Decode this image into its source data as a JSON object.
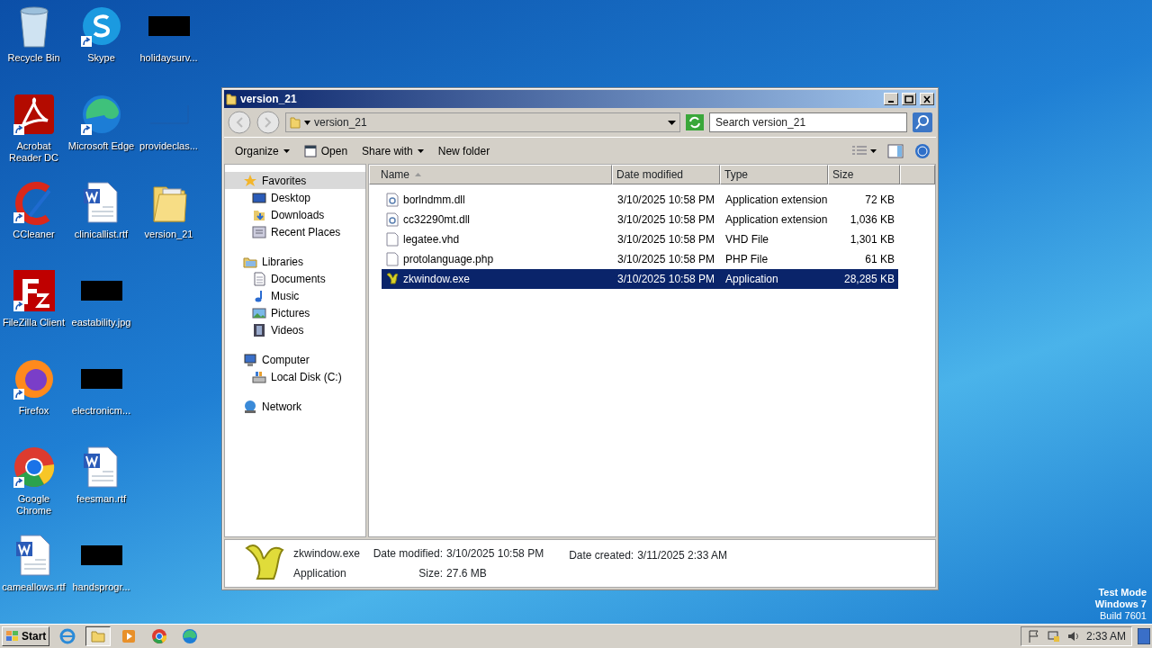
{
  "desktop_icons": [
    {
      "label": "Recycle Bin",
      "kind": "recycle-bin",
      "shortcut": false
    },
    {
      "label": "Acrobat Reader DC",
      "kind": "acrobat",
      "shortcut": true
    },
    {
      "label": "CCleaner",
      "kind": "ccleaner",
      "shortcut": true
    },
    {
      "label": "FileZilla Client",
      "kind": "filezilla",
      "shortcut": true
    },
    {
      "label": "Firefox",
      "kind": "firefox",
      "shortcut": true
    },
    {
      "label": "Google Chrome",
      "kind": "chrome",
      "shortcut": true
    },
    {
      "label": "cameallows.rtf",
      "kind": "word-doc",
      "shortcut": false
    },
    {
      "label": "Skype",
      "kind": "skype",
      "shortcut": true
    },
    {
      "label": "Microsoft Edge",
      "kind": "edge",
      "shortcut": true
    },
    {
      "label": "clinicallist.rtf",
      "kind": "word-doc",
      "shortcut": false
    },
    {
      "label": "eastability.jpg",
      "kind": "hidden",
      "shortcut": false
    },
    {
      "label": "electronicm...",
      "kind": "hidden",
      "shortcut": false
    },
    {
      "label": "feesman.rtf",
      "kind": "word-doc",
      "shortcut": false
    },
    {
      "label": "handsprogr...",
      "kind": "hidden",
      "shortcut": false
    },
    {
      "label": "holidaysurv...",
      "kind": "hidden",
      "shortcut": false
    },
    {
      "label": "provideclas...",
      "kind": "blank",
      "shortcut": false
    },
    {
      "label": "version_21",
      "kind": "folder",
      "shortcut": false
    }
  ],
  "window": {
    "title": "version_21",
    "address": {
      "path": "version_21"
    },
    "search": {
      "placeholder": "Search version_21"
    },
    "toolbar": [
      {
        "label": "Organize",
        "kind": "menu"
      },
      {
        "label": "Open",
        "kind": "open"
      },
      {
        "label": "Share with",
        "kind": "menu"
      },
      {
        "label": "New folder",
        "kind": "plain"
      }
    ],
    "sidebar": [
      {
        "label": "Favorites",
        "kind": "star",
        "selected": true,
        "children": [
          {
            "label": "Desktop",
            "kind": "desktop",
            "selected": false
          },
          {
            "label": "Downloads",
            "kind": "downloads",
            "selected": false
          },
          {
            "label": "Recent Places",
            "kind": "recent",
            "selected": false
          }
        ]
      },
      {
        "label": "Libraries",
        "kind": "libraries",
        "selected": false,
        "children": [
          {
            "label": "Documents",
            "kind": "documents",
            "selected": false
          },
          {
            "label": "Music",
            "kind": "music",
            "selected": false
          },
          {
            "label": "Pictures",
            "kind": "pictures",
            "selected": false
          },
          {
            "label": "Videos",
            "kind": "videos",
            "selected": false
          }
        ]
      },
      {
        "label": "Computer",
        "kind": "computer",
        "selected": false,
        "children": [
          {
            "label": "Local Disk (C:)",
            "kind": "disk",
            "selected": false
          }
        ]
      },
      {
        "label": "Network",
        "kind": "network",
        "selected": false
      }
    ],
    "columns": [
      {
        "label": "Name",
        "sorted": true
      },
      {
        "label": "Date modified",
        "sorted": false
      },
      {
        "label": "Type",
        "sorted": false
      },
      {
        "label": "Size",
        "sorted": false
      }
    ],
    "files": [
      {
        "name": "borlndmm.dll",
        "date": "3/10/2025 10:58 PM",
        "type": "Application extension",
        "size": "72 KB",
        "kind": "dll",
        "selected": false
      },
      {
        "name": "cc32290mt.dll",
        "date": "3/10/2025 10:58 PM",
        "type": "Application extension",
        "size": "1,036 KB",
        "kind": "dll",
        "selected": false
      },
      {
        "name": "legatee.vhd",
        "date": "3/10/2025 10:58 PM",
        "type": "VHD File",
        "size": "1,301 KB",
        "kind": "file",
        "selected": false
      },
      {
        "name": "protolanguage.php",
        "date": "3/10/2025 10:58 PM",
        "type": "PHP File",
        "size": "61 KB",
        "kind": "file",
        "selected": false
      },
      {
        "name": "zkwindow.exe",
        "date": "3/10/2025 10:58 PM",
        "type": "Application",
        "size": "28,285 KB",
        "kind": "app",
        "selected": true
      }
    ],
    "details": {
      "name": "zkwindow.exe",
      "type": "Application",
      "date_modified_label": "Date modified:",
      "date_modified": "3/10/2025 10:58 PM",
      "date_created_label": "Date created:",
      "date_created": "3/11/2025 2:33 AM",
      "size_label": "Size:",
      "size": "27.6 MB"
    }
  },
  "desktop_notice": [
    "Test Mode",
    "Windows 7",
    "Build 7601"
  ],
  "taskbar": {
    "start": "Start",
    "apps": [
      {
        "kind": "ie",
        "active": false
      },
      {
        "kind": "explorer",
        "active": true
      },
      {
        "kind": "media",
        "active": false
      },
      {
        "kind": "chrome",
        "active": false
      },
      {
        "kind": "edge",
        "active": false
      }
    ],
    "tray": [
      {
        "kind": "flag"
      },
      {
        "kind": "network"
      },
      {
        "kind": "volume"
      }
    ],
    "clock": "2:33 AM"
  }
}
